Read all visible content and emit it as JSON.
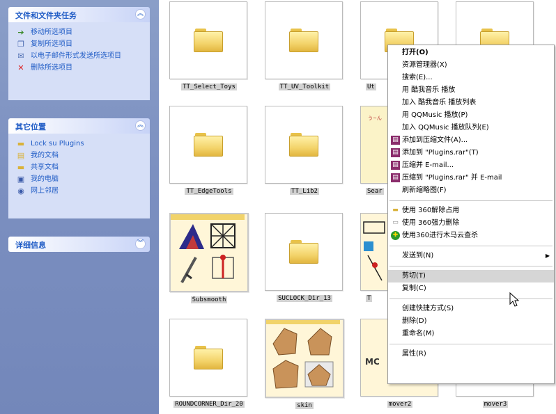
{
  "taskpane": {
    "file_tasks": {
      "title": "文件和文件夹任务",
      "items": [
        {
          "label": "移动所选项目",
          "icon": "move-folder-icon"
        },
        {
          "label": "复制所选项目",
          "icon": "copy-icon"
        },
        {
          "label": "以电子邮件形式发送所选项目",
          "icon": "email-icon"
        },
        {
          "label": "删除所选项目",
          "icon": "delete-icon"
        }
      ]
    },
    "other_places": {
      "title": "其它位置",
      "items": [
        {
          "label": "Lock su Plugins",
          "icon": "folder-icon"
        },
        {
          "label": "我的文档",
          "icon": "my-documents-icon"
        },
        {
          "label": "共享文档",
          "icon": "shared-folder-icon"
        },
        {
          "label": "我的电脑",
          "icon": "computer-icon"
        },
        {
          "label": "网上邻居",
          "icon": "network-icon"
        }
      ]
    },
    "details": {
      "title": "详细信息"
    }
  },
  "files": [
    {
      "name": "TT_Select_Toys",
      "type": "folder"
    },
    {
      "name": "TT_UV_Toolkit",
      "type": "folder"
    },
    {
      "name": "Ut",
      "type": "folder"
    },
    {
      "name": "",
      "type": "folder"
    },
    {
      "name": "TT_EdgeTools",
      "type": "folder"
    },
    {
      "name": "TT_Lib2",
      "type": "folder"
    },
    {
      "name": "Sear",
      "type": "folder-preview"
    },
    {
      "name": "Subsmooth",
      "type": "folder-preview"
    },
    {
      "name": "SUCLOCK_Dir_13",
      "type": "folder"
    },
    {
      "name": "T",
      "type": "folder-preview"
    },
    {
      "name": "ROUNDCORNER_Dir_20",
      "type": "folder"
    },
    {
      "name": "skin",
      "type": "folder-preview"
    },
    {
      "name": "mover2",
      "type": "folder-preview"
    },
    {
      "name": "mover3",
      "type": "folder-preview"
    }
  ],
  "context_menu": {
    "items": [
      {
        "label": "打开(O)",
        "bold": true
      },
      {
        "label": "资源管理器(X)"
      },
      {
        "label": "搜索(E)..."
      },
      {
        "label": "用 酷我音乐 播放"
      },
      {
        "label": "加入 酷我音乐 播放列表"
      },
      {
        "label": "用 QQMusic 播放(P)"
      },
      {
        "label": "加入 QQMusic 播放队列(E)"
      },
      {
        "label": "添加到压缩文件(A)...",
        "icon": "winrar-icon"
      },
      {
        "label": "添加到 \"Plugins.rar\"(T)",
        "icon": "winrar-icon"
      },
      {
        "label": "压缩并 E-mail...",
        "icon": "winrar-icon"
      },
      {
        "label": "压缩到 \"Plugins.rar\" 并 E-mail",
        "icon": "winrar-icon"
      },
      {
        "label": "刷新缩略图(F)"
      },
      {
        "separator": true
      },
      {
        "label": "使用 360解除占用",
        "icon": "360-unlock-icon"
      },
      {
        "label": "使用 360强力删除",
        "icon": "360-delete-icon"
      },
      {
        "label": "使用360进行木马云查杀",
        "icon": "360-scan-icon"
      },
      {
        "separator": true
      },
      {
        "label": "发送到(N)",
        "submenu": true
      },
      {
        "separator": true
      },
      {
        "label": "剪切(T)",
        "highlighted": true
      },
      {
        "label": "复制(C)"
      },
      {
        "separator": true
      },
      {
        "label": "创建快捷方式(S)"
      },
      {
        "label": "删除(D)"
      },
      {
        "label": "重命名(M)"
      },
      {
        "separator": true
      },
      {
        "label": "属性(R)"
      }
    ]
  },
  "colors": {
    "taskpane_bg": "#7b8fc0",
    "panel_body": "#d6dff7",
    "link": "#215dc6",
    "folder_yellow": "#f3d36a",
    "menu_highlight": "#d6d6d6"
  }
}
